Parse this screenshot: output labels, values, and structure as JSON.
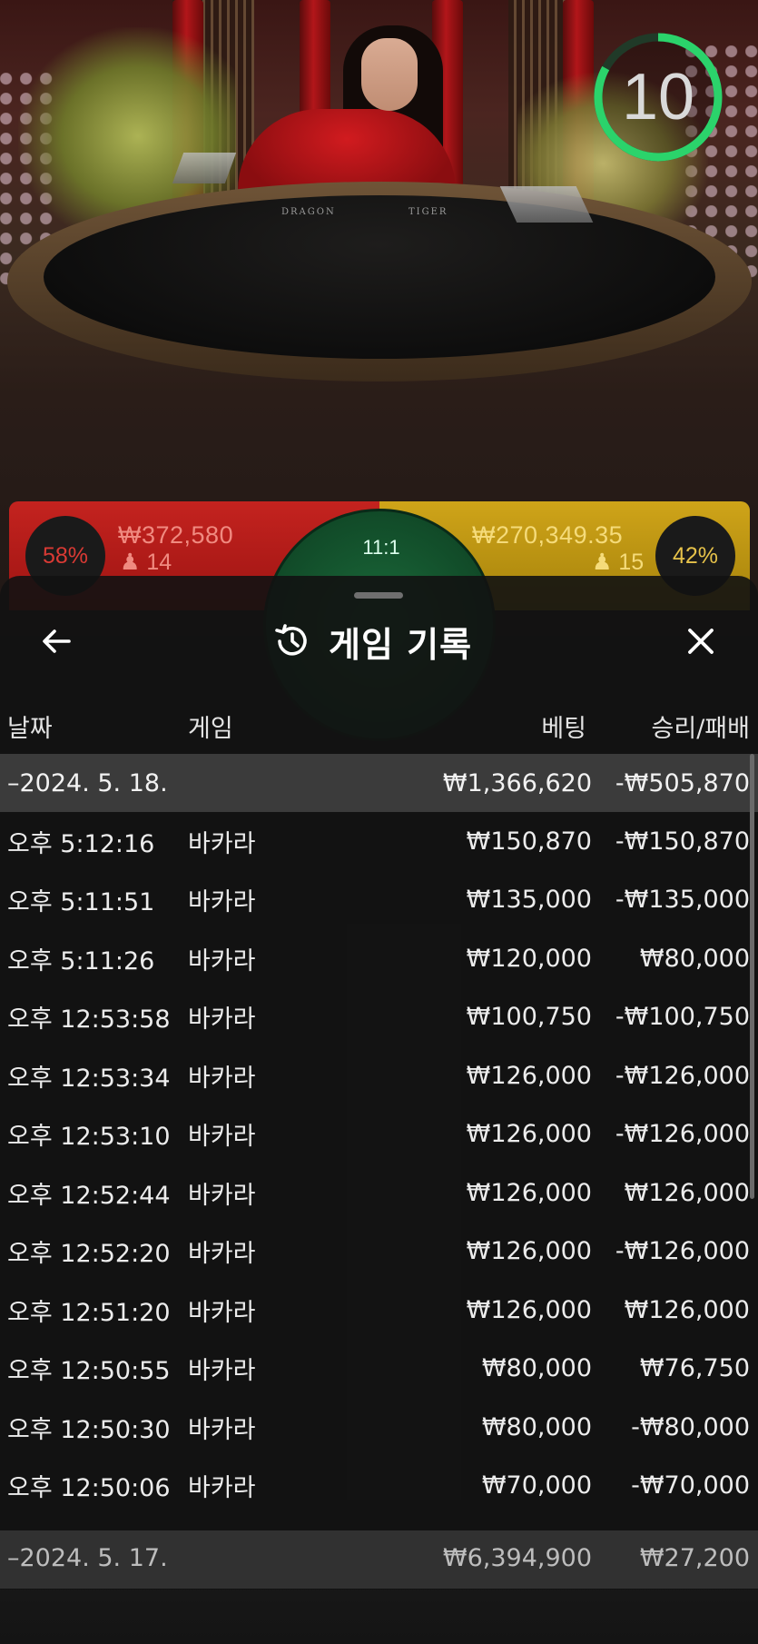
{
  "game_view": {
    "timer": "10",
    "timer_progress": 0.83,
    "table_labels": {
      "dragon": "DRAGON",
      "tiger": "TIGER"
    },
    "dragon": {
      "percent": "58%",
      "amount": "₩372,580",
      "players": "14"
    },
    "tiger": {
      "percent": "42%",
      "amount": "₩270,349.35",
      "players": "15"
    },
    "payout": "11:1",
    "colors": {
      "dragon": "#c4231f",
      "tiger": "#cfa419",
      "timer_ring": "#2bd36b"
    }
  },
  "history": {
    "title": "게임 기록",
    "icons": {
      "back": "arrow-left-icon",
      "history": "history-clock-icon",
      "close": "close-icon"
    },
    "columns": {
      "date": "날짜",
      "game": "게임",
      "bet": "베팅",
      "result": "승리/패배"
    },
    "day": {
      "date": "–2024. 5. 18.",
      "bet": "₩1,366,620",
      "result": "-₩505,870"
    },
    "rows": [
      {
        "time": "오후 5:12:16",
        "game": "바카라",
        "bet": "₩150,870",
        "result": "-₩150,870"
      },
      {
        "time": "오후 5:11:51",
        "game": "바카라",
        "bet": "₩135,000",
        "result": "-₩135,000"
      },
      {
        "time": "오후 5:11:26",
        "game": "바카라",
        "bet": "₩120,000",
        "result": "₩80,000"
      },
      {
        "time": "오후 12:53:58",
        "game": "바카라",
        "bet": "₩100,750",
        "result": "-₩100,750"
      },
      {
        "time": "오후 12:53:34",
        "game": "바카라",
        "bet": "₩126,000",
        "result": "-₩126,000"
      },
      {
        "time": "오후 12:53:10",
        "game": "바카라",
        "bet": "₩126,000",
        "result": "-₩126,000"
      },
      {
        "time": "오후 12:52:44",
        "game": "바카라",
        "bet": "₩126,000",
        "result": "₩126,000"
      },
      {
        "time": "오후 12:52:20",
        "game": "바카라",
        "bet": "₩126,000",
        "result": "-₩126,000"
      },
      {
        "time": "오후 12:51:20",
        "game": "바카라",
        "bet": "₩126,000",
        "result": "₩126,000"
      },
      {
        "time": "오후 12:50:55",
        "game": "바카라",
        "bet": "₩80,000",
        "result": "₩76,750"
      },
      {
        "time": "오후 12:50:30",
        "game": "바카라",
        "bet": "₩80,000",
        "result": "-₩80,000"
      },
      {
        "time": "오후 12:50:06",
        "game": "바카라",
        "bet": "₩70,000",
        "result": "-₩70,000"
      }
    ],
    "next_day": {
      "date": "–2024. 5. 17.",
      "bet": "₩6,394,900",
      "result": "₩27,200"
    }
  }
}
